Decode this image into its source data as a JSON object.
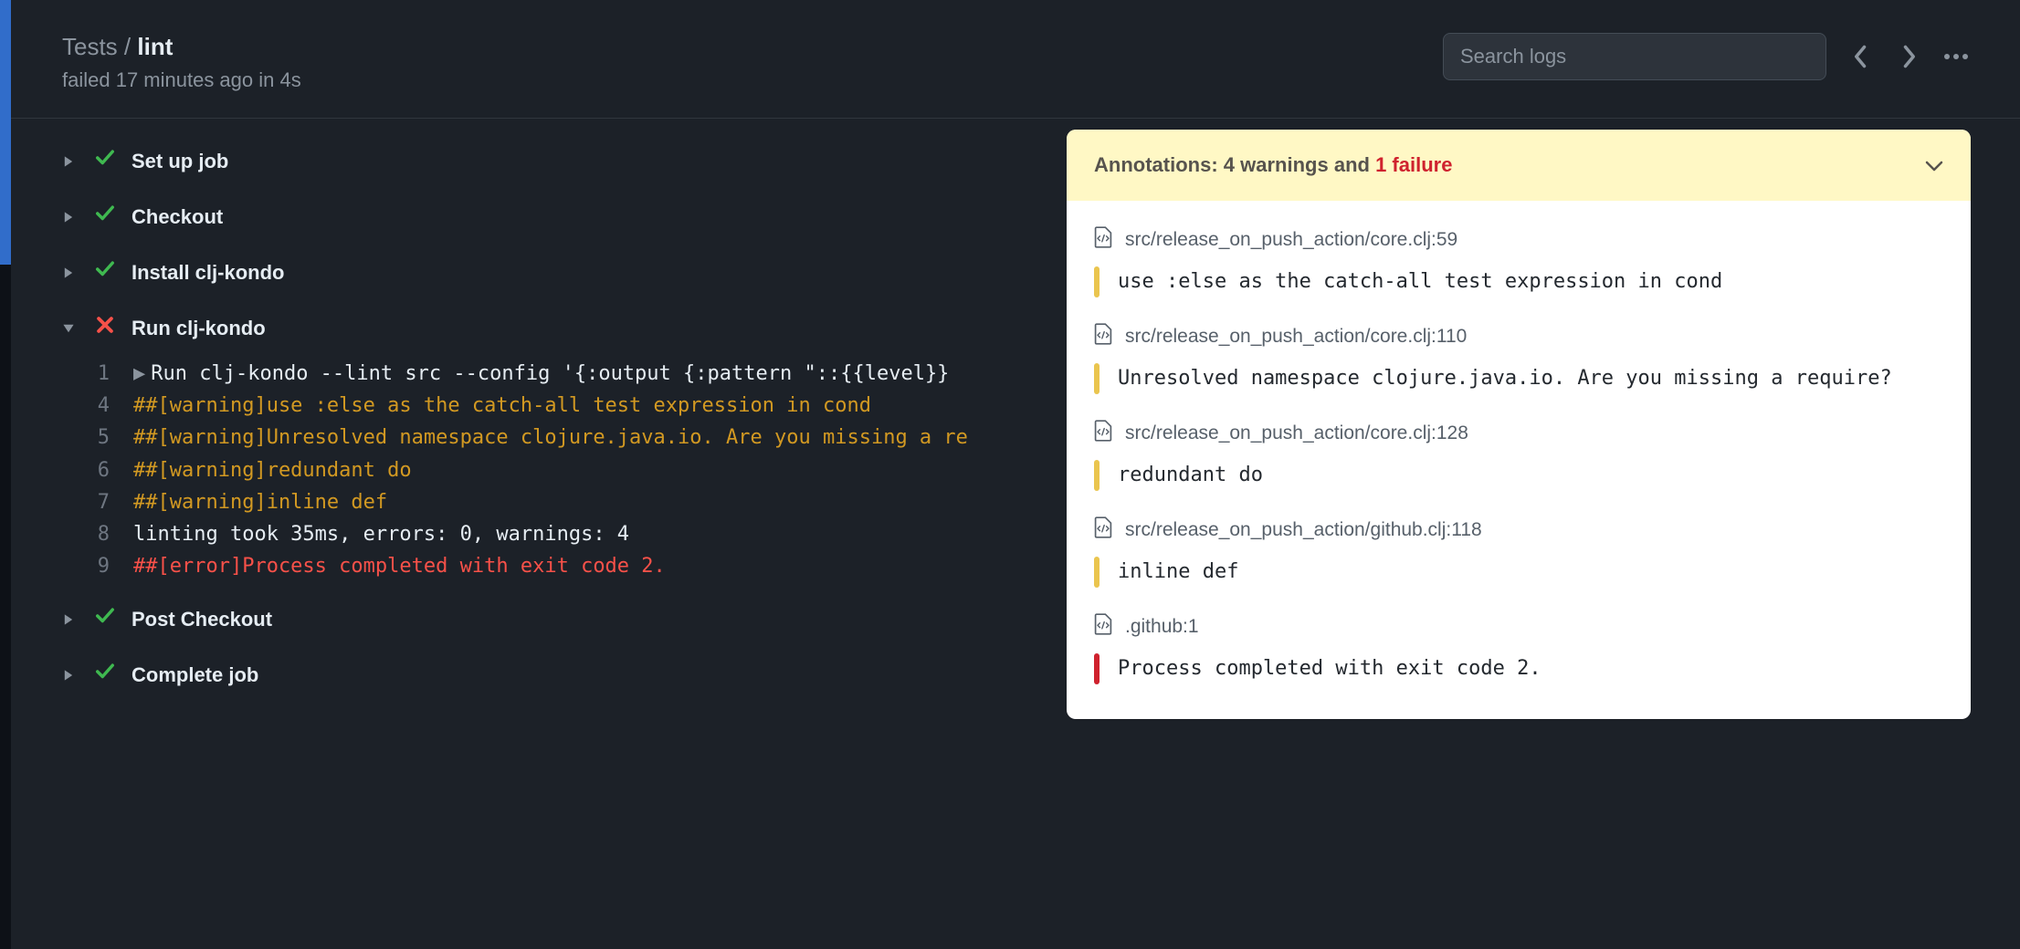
{
  "header": {
    "breadcrumb_prefix": "Tests",
    "breadcrumb_sep": "/",
    "breadcrumb_name": "lint",
    "subline": "failed 17 minutes ago in 4s",
    "search_placeholder": "Search logs"
  },
  "steps": [
    {
      "label": "Set up job",
      "status": "success",
      "expanded": false
    },
    {
      "label": "Checkout",
      "status": "success",
      "expanded": false
    },
    {
      "label": "Install clj-kondo",
      "status": "success",
      "expanded": false
    },
    {
      "label": "Run clj-kondo",
      "status": "failed",
      "expanded": true,
      "logs": [
        {
          "n": "1",
          "kind": "cmd",
          "text": "Run clj-kondo --lint src --config '{:output {:pattern \"::{{level}}"
        },
        {
          "n": "4",
          "kind": "warn",
          "text": "##[warning]use :else as the catch-all test expression in cond"
        },
        {
          "n": "5",
          "kind": "warn",
          "text": "##[warning]Unresolved namespace clojure.java.io. Are you missing a re"
        },
        {
          "n": "6",
          "kind": "warn",
          "text": "##[warning]redundant do"
        },
        {
          "n": "7",
          "kind": "warn",
          "text": "##[warning]inline def"
        },
        {
          "n": "8",
          "kind": "plain",
          "text": "linting took 35ms, errors: 0, warnings: 4"
        },
        {
          "n": "9",
          "kind": "err",
          "text": "##[error]Process completed with exit code 2."
        }
      ]
    },
    {
      "label": "Post Checkout",
      "status": "success",
      "expanded": false
    },
    {
      "label": "Complete job",
      "status": "success",
      "expanded": false
    }
  ],
  "annotations": {
    "header_prefix": "Annotations:",
    "warnings_text": "4 warnings",
    "and_text": "and",
    "failure_text": "1 failure",
    "items": [
      {
        "location": "src/release_on_push_action/core.clj:59",
        "severity": "warn",
        "message": "use :else as the catch-all test expression in cond"
      },
      {
        "location": "src/release_on_push_action/core.clj:110",
        "severity": "warn",
        "message": "Unresolved namespace clojure.java.io. Are you missing a require?"
      },
      {
        "location": "src/release_on_push_action/core.clj:128",
        "severity": "warn",
        "message": "redundant do"
      },
      {
        "location": "src/release_on_push_action/github.clj:118",
        "severity": "warn",
        "message": "inline def"
      },
      {
        "location": ".github:1",
        "severity": "err",
        "message": "Process completed with exit code 2."
      }
    ]
  }
}
